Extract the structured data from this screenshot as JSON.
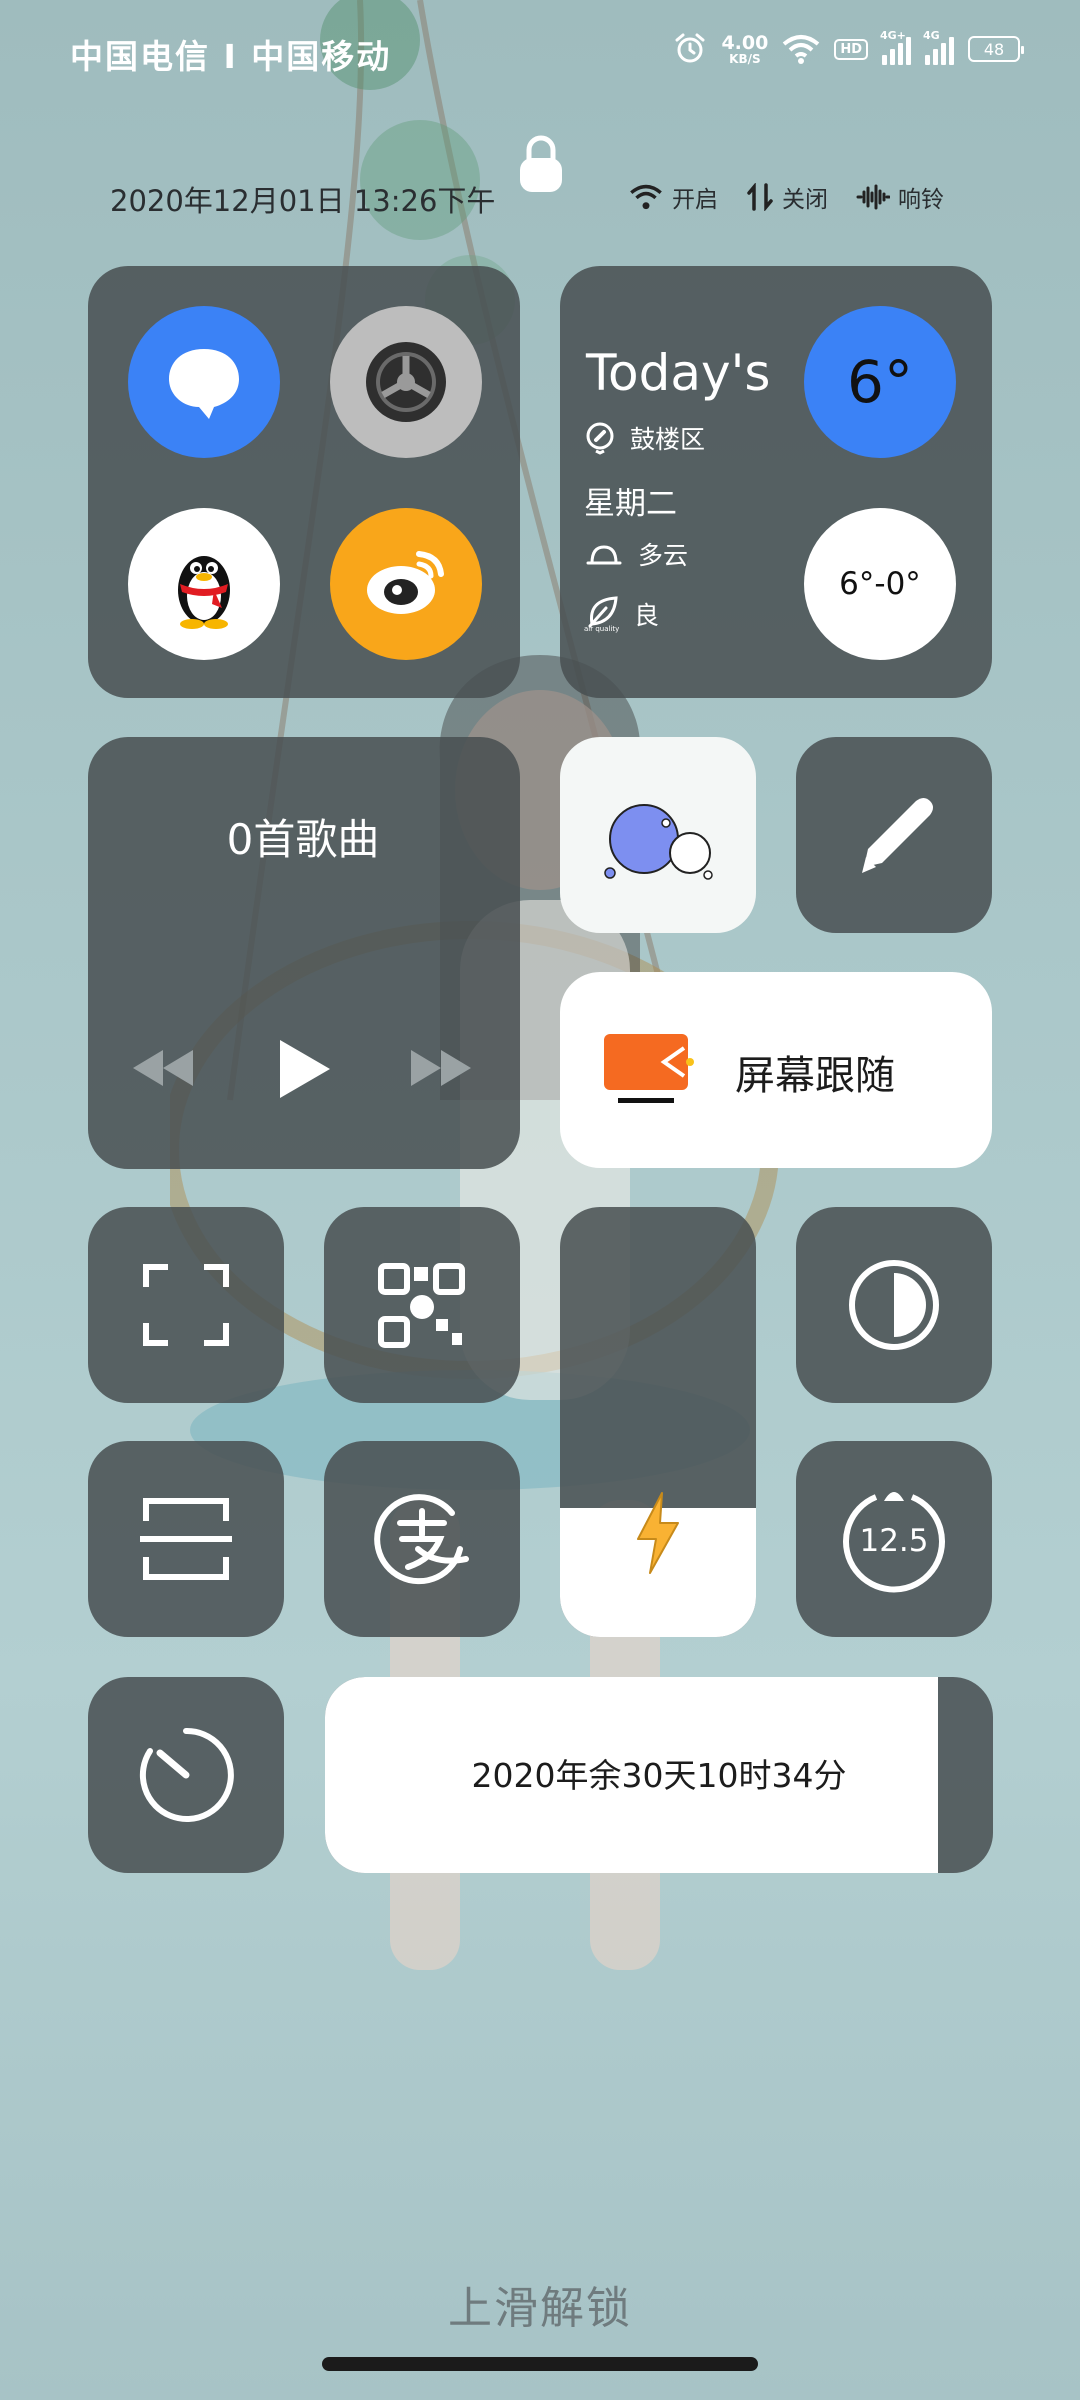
{
  "status_bar": {
    "carrier": "中国电信 I 中国移动",
    "net_speed_value": "4.00",
    "net_speed_unit": "KB/S",
    "hd": "HD",
    "sim1": "4G+",
    "sim2": "4G",
    "battery": "48"
  },
  "header": {
    "datetime": "2020年12月01日 13:26下午",
    "wifi_label": "开启",
    "data_label": "关闭",
    "sound_label": "响铃"
  },
  "weather": {
    "title": "Today's",
    "location": "鼓楼区",
    "weekday": "星期二",
    "condition": "多云",
    "air_quality": "良",
    "temp_now": "6°",
    "temp_range": "6°-0°",
    "aq_caption": "air quality"
  },
  "music": {
    "title": "0首歌曲"
  },
  "screen_follow": {
    "label": "屏幕跟随"
  },
  "timer": {
    "value": "12.5"
  },
  "year_progress": {
    "label": "2020年余30天10时34分",
    "fraction": 0.918
  },
  "lockscreen": {
    "unlock_hint": "上滑解锁"
  },
  "brightness": {
    "level": 0.3
  },
  "colors": {
    "tile_dark": "#484f51",
    "accent_blue": "#3b82f6",
    "weibo_orange": "#f9a61a",
    "follow_orange": "#f56a21"
  }
}
